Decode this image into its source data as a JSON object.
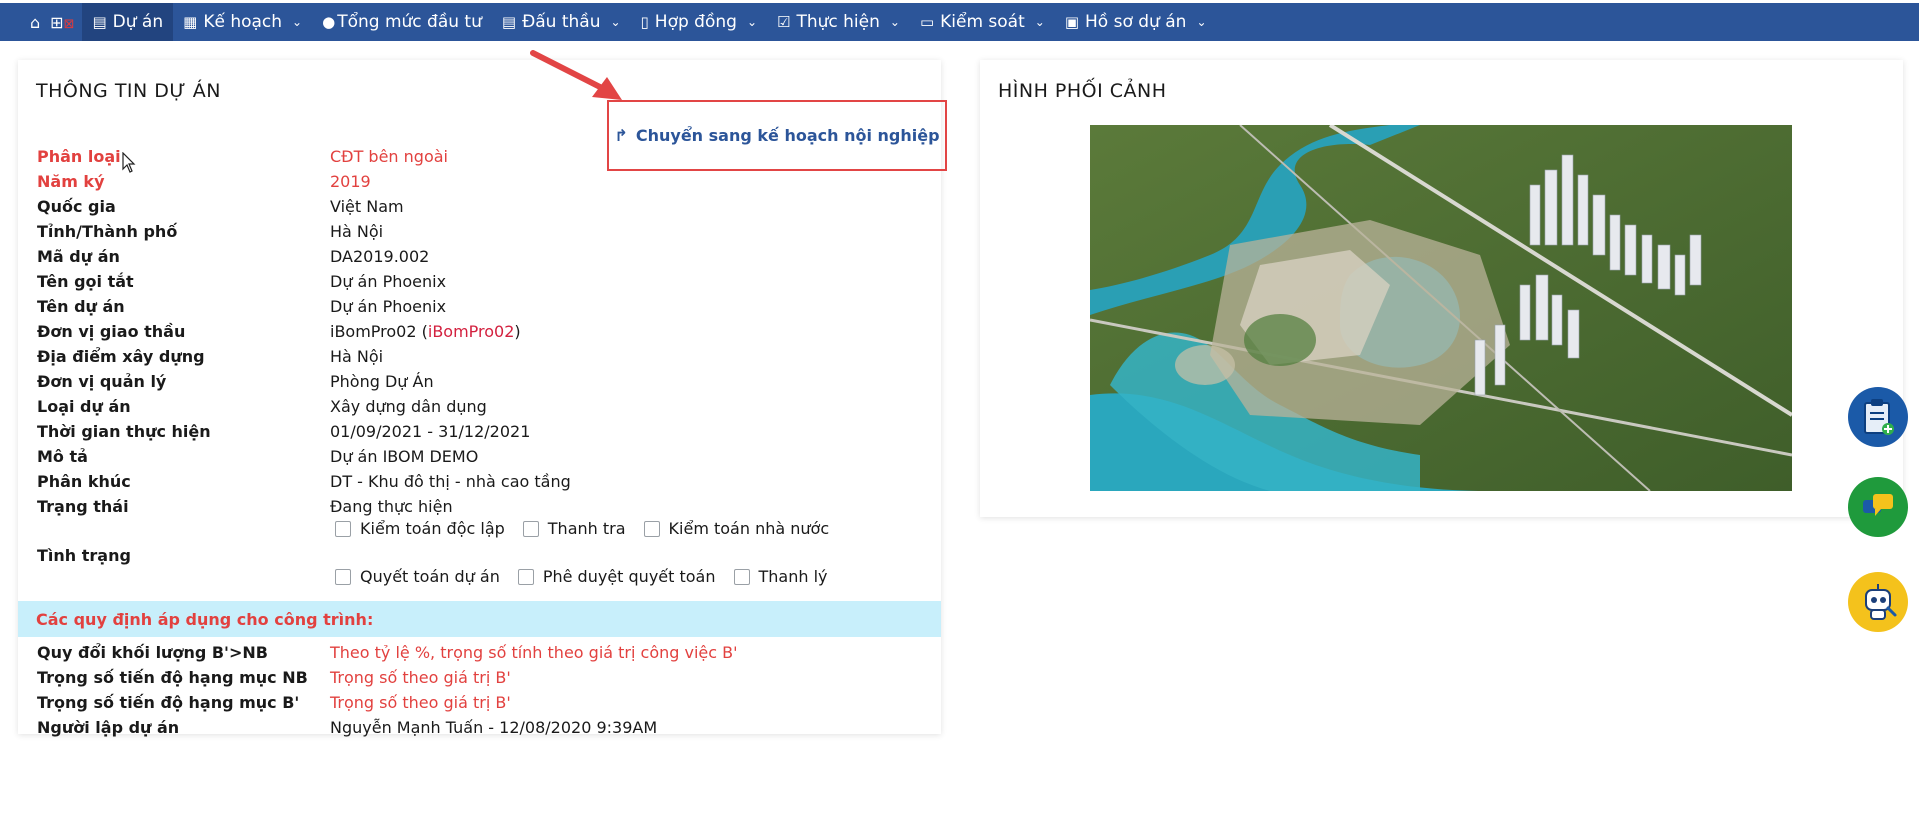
{
  "nav": {
    "items": [
      {
        "label": "Dự án",
        "icon": "project-icon",
        "active": true,
        "dropdown": false
      },
      {
        "label": "Kế hoạch",
        "icon": "plan-icon",
        "active": false,
        "dropdown": true
      },
      {
        "label": "Tổng mức đầu tư",
        "icon": "money-bag-icon",
        "active": false,
        "dropdown": false
      },
      {
        "label": "Đấu thầu",
        "icon": "bid-icon",
        "active": false,
        "dropdown": true
      },
      {
        "label": "Hợp đồng",
        "icon": "contract-icon",
        "active": false,
        "dropdown": true
      },
      {
        "label": "Thực hiện",
        "icon": "check-icon",
        "active": false,
        "dropdown": true
      },
      {
        "label": "Kiểm soát",
        "icon": "monitor-icon",
        "active": false,
        "dropdown": true
      },
      {
        "label": "Hồ sơ dự án",
        "icon": "briefcase-icon",
        "active": false,
        "dropdown": true
      }
    ]
  },
  "project_info": {
    "title": "THÔNG TIN DỰ ÁN",
    "move_button": "Chuyển sang kế hoạch nội nghiệp",
    "fields": [
      {
        "label": "Phân loại",
        "value": "CĐT bên ngoài",
        "highlight": true
      },
      {
        "label": "Năm ký",
        "value": "2019",
        "highlight": true
      },
      {
        "label": "Quốc gia",
        "value": "Việt Nam"
      },
      {
        "label": "Tỉnh/Thành phố",
        "value": "Hà Nội"
      },
      {
        "label": "Mã dự án",
        "value": "DA2019.002"
      },
      {
        "label": "Tên gọi tắt",
        "value": "Dự án Phoenix"
      },
      {
        "label": "Tên dự án",
        "value": "Dự án Phoenix"
      },
      {
        "label": "Đơn vị giao thầu",
        "value": "iBomPro02 (",
        "link": "iBomPro02",
        "suffix": ")"
      },
      {
        "label": "Địa điểm xây dựng",
        "value": "Hà Nội"
      },
      {
        "label": "Đơn vị quản lý",
        "value": "Phòng Dự Án"
      },
      {
        "label": "Loại dự án",
        "value": "Xây dựng dân dụng"
      },
      {
        "label": "Thời gian thực hiện",
        "value": "01/09/2021 - 31/12/2021"
      },
      {
        "label": "Mô tả",
        "value": "Dự án IBOM DEMO"
      },
      {
        "label": "Phân khúc",
        "value": "DT - Khu đô thị - nhà cao tầng"
      },
      {
        "label": "Trạng thái",
        "value": "Đang thực hiện"
      }
    ],
    "status_label": "Tình trạng",
    "checks_row1": [
      "Kiểm toán độc lập",
      "Thanh tra",
      "Kiểm toán nhà nước"
    ],
    "checks_row2": [
      "Quyết toán dự án",
      "Phê duyệt quyết toán",
      "Thanh lý"
    ],
    "rules_title": "Các quy định áp dụng cho công trình:",
    "rules": [
      {
        "label": "Quy đổi khối lượng B'>NB",
        "value": "Theo tỷ lệ %, trọng số tính theo giá trị công việc B'",
        "highlight": true
      },
      {
        "label": "Trọng số tiến độ hạng mục NB",
        "value": "Trọng số theo giá trị B'",
        "highlight": true
      },
      {
        "label": "Trọng số tiến độ hạng mục B'",
        "value": "Trọng số theo giá trị B'",
        "highlight": true
      },
      {
        "label": "Người lập dự án",
        "value": "Nguyễn Mạnh Tuấn - 12/08/2020 9:39AM",
        "highlight": false
      }
    ]
  },
  "perspective": {
    "title": "HÌNH PHỐI CẢNH"
  },
  "colors": {
    "nav_bg": "#2c5599",
    "accent_red": "#e2413f",
    "rules_bg": "#c8effb"
  }
}
